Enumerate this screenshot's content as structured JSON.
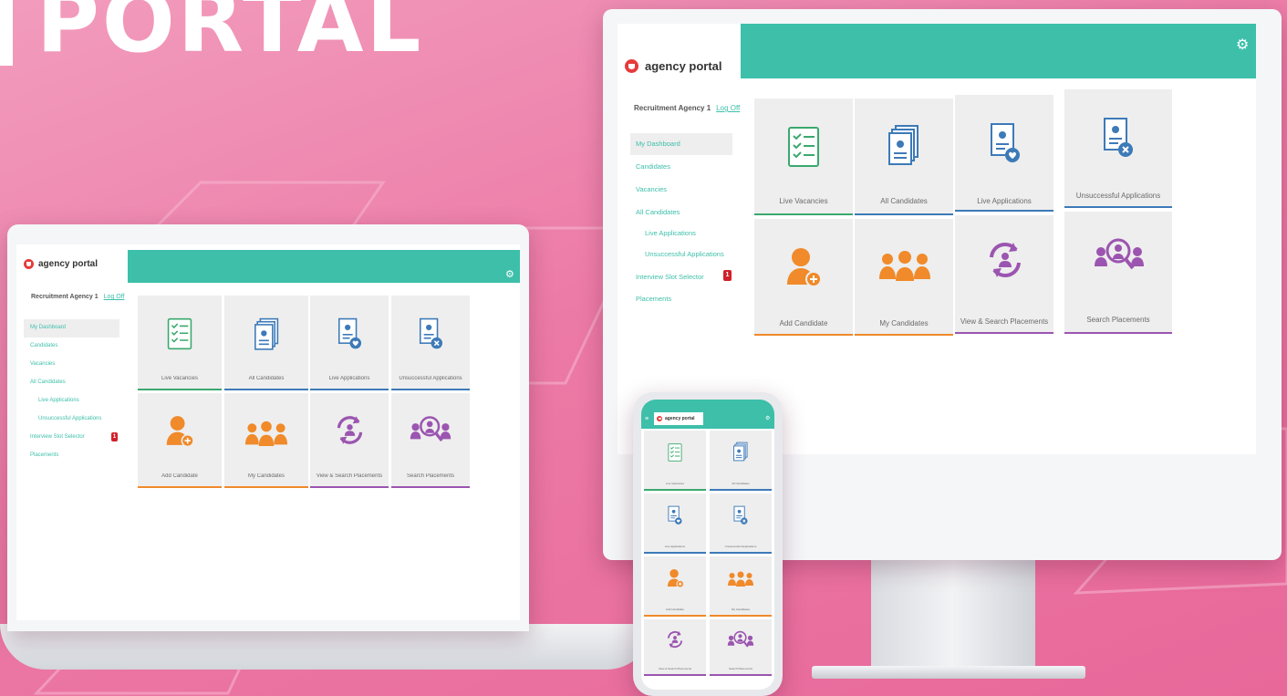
{
  "banner": "PORTAL",
  "app": {
    "name": "agency portal"
  },
  "account": {
    "name": "Recruitment Agency 1",
    "logoff": "Log Off"
  },
  "nav": [
    {
      "label": "My Dashboard",
      "active": true,
      "indent": false
    },
    {
      "label": "Candidates",
      "active": false,
      "indent": false
    },
    {
      "label": "Vacancies",
      "active": false,
      "indent": false
    },
    {
      "label": "All Candidates",
      "active": false,
      "indent": false
    },
    {
      "label": "Live Applications",
      "active": false,
      "indent": true
    },
    {
      "label": "Unsuccessful Applications",
      "active": false,
      "indent": true
    },
    {
      "label": "Interview Slot Selector",
      "active": false,
      "indent": false,
      "badge": "1"
    },
    {
      "label": "Placements",
      "active": false,
      "indent": false
    }
  ],
  "tiles": [
    {
      "label": "Live Vacancies",
      "icon": "checklist-icon",
      "accent": "green"
    },
    {
      "label": "All Candidates",
      "icon": "documents-icon",
      "accent": "blue"
    },
    {
      "label": "Live Applications",
      "icon": "document-heart-icon",
      "accent": "blue"
    },
    {
      "label": "Unsuccessful Applications",
      "icon": "document-cross-icon",
      "accent": "blue"
    },
    {
      "label": "Add Candidate",
      "icon": "add-person-icon",
      "accent": "orange"
    },
    {
      "label": "My Candidates",
      "icon": "people-group-icon",
      "accent": "orange"
    },
    {
      "label": "View & Search Placements",
      "icon": "refresh-person-icon",
      "accent": "purple"
    },
    {
      "label": "Search Placements",
      "icon": "search-people-icon",
      "accent": "purple"
    }
  ],
  "colors": {
    "header": "#3dbfaa",
    "green": "#3aa86e",
    "blue": "#3d7ab8",
    "orange": "#f08a2a",
    "purple": "#9b55b0",
    "badge": "#d0202a",
    "background": "#ec7aa6"
  },
  "icons": {
    "settings": "gear-icon",
    "menu": "hamburger-icon",
    "logo": "agency-logo-icon"
  }
}
